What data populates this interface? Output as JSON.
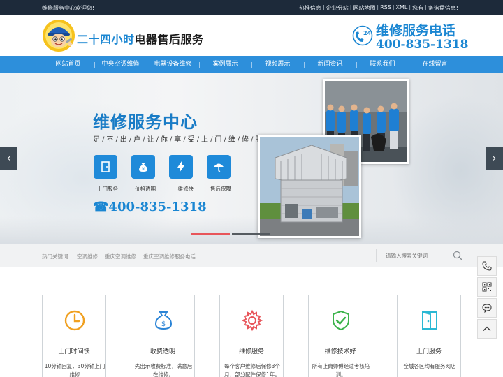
{
  "topbar": {
    "welcome": "维修服务中心欢迎您!",
    "links": [
      "热推信息",
      "企业分站",
      "网站地图",
      "RSS",
      "XML",
      "您有",
      "条询盘信息!"
    ]
  },
  "header": {
    "title_prefix": "二十四小时",
    "title_suffix": "电器售后服务",
    "badge_number": "24",
    "hotline_label": "维修服务电话",
    "hotline_number": "400-835-1318"
  },
  "nav": {
    "items": [
      "网站首页",
      "中央空调维修",
      "电器设备维修",
      "案例展示",
      "视频展示",
      "新闻资讯",
      "联系我们",
      "在线留言"
    ]
  },
  "banner": {
    "title": "维修服务中心",
    "subtitle": "足/不/出/户/让/你/享/受/上/门/维/修/服/务",
    "features": [
      {
        "label": "上门服务",
        "icon": "door-icon"
      },
      {
        "label": "价格透明",
        "icon": "money-bag-icon"
      },
      {
        "label": "维修快",
        "icon": "lightning-icon"
      },
      {
        "label": "售后保障",
        "icon": "umbrella-icon"
      }
    ],
    "phone": "☎400-835-1318",
    "prev_arrow": "‹",
    "next_arrow": "›",
    "active_slide": 1,
    "slide_count": 2
  },
  "search": {
    "hot_label": "热门关键词:",
    "keywords": [
      "空调维修",
      "重庆空调维修",
      "重庆空调维修服务电话"
    ],
    "placeholder": "请输入搜索关键词"
  },
  "services": [
    {
      "title": "上门时间快",
      "desc": "10分钟回复，30分钟上门维修",
      "icon": "clock-icon"
    },
    {
      "title": "收费透明",
      "desc": "先出示收费标准，满意后在维修。",
      "icon": "money-bag-icon"
    },
    {
      "title": "维修服务",
      "desc": "每个客户维修后保修3个月，部分配件保修1年。",
      "icon": "gear-icon"
    },
    {
      "title": "维修技术好",
      "desc": "所有上岗师傅经过考核培训。",
      "icon": "shield-check-icon"
    },
    {
      "title": "上门服务",
      "desc": "全城各区均有服务网店",
      "icon": "door-icon"
    }
  ],
  "colors": {
    "brand_blue": "#2d8fdb",
    "title_blue": "#1a86d2",
    "topbar_bg": "#1d2a3a",
    "icon_orange": "#f0a020",
    "icon_green": "#3bb34a",
    "icon_teal": "#2bb8d4",
    "icon_red": "#e8555a"
  }
}
